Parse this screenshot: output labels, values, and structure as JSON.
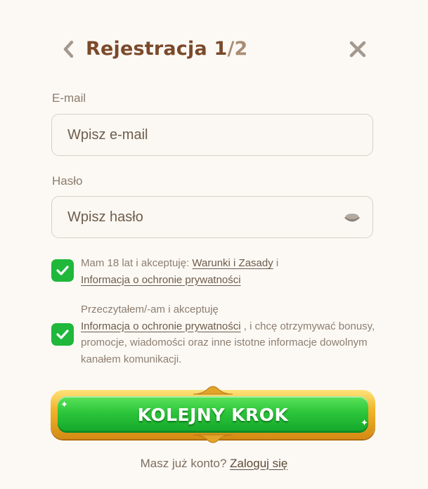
{
  "header": {
    "title_main": "Rejestracja 1",
    "title_total": "/2",
    "back_icon": "chevron-left-icon",
    "close_icon": "close-icon"
  },
  "form": {
    "email": {
      "label": "E-mail",
      "placeholder": "Wpisz e-mail",
      "value": ""
    },
    "password": {
      "label": "Hasło",
      "placeholder": "Wpisz hasło",
      "value": "",
      "toggle_icon": "eye-icon"
    }
  },
  "consents": [
    {
      "checked": true,
      "text_before": "Mam 18 lat i akceptuję: ",
      "link1": "Warunki i Zasady",
      "text_mid": " i",
      "link2": "Informacja o ochronie prywatności"
    },
    {
      "checked": true,
      "text_before": "Przeczytałem/-am i akceptuję",
      "link1": "Informacja o ochronie prywatności",
      "text_after": " , i chcę otrzymywać bonusy, promocje, wiadomości oraz inne istotne informacje dowolnym kanałem komunikacji."
    }
  ],
  "cta": {
    "label": "KOLEJNY KROK"
  },
  "footer": {
    "text": "Masz już konto? ",
    "link": "Zaloguj się"
  },
  "colors": {
    "background": "#fcf9f5",
    "title": "#7b4a2a",
    "checkbox": "#1fb83a",
    "cta_green": "#2cc53a",
    "cta_gold": "#f1b52a"
  }
}
